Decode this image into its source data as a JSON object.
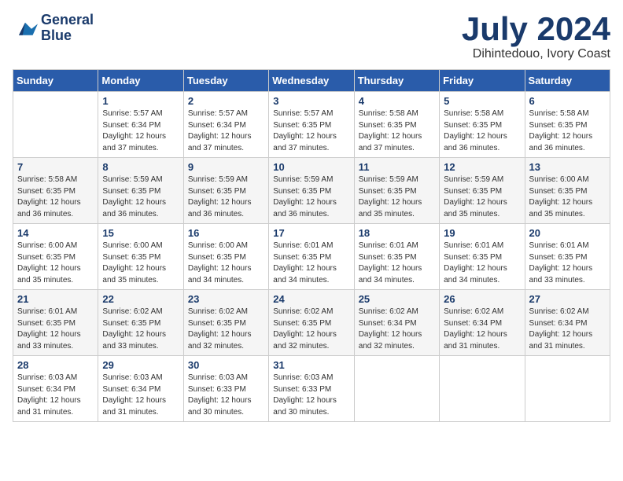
{
  "logo": {
    "line1": "General",
    "line2": "Blue"
  },
  "title": "July 2024",
  "location": "Dihintedouo, Ivory Coast",
  "headers": [
    "Sunday",
    "Monday",
    "Tuesday",
    "Wednesday",
    "Thursday",
    "Friday",
    "Saturday"
  ],
  "weeks": [
    [
      {
        "day": "",
        "info": ""
      },
      {
        "day": "1",
        "info": "Sunrise: 5:57 AM\nSunset: 6:34 PM\nDaylight: 12 hours\nand 37 minutes."
      },
      {
        "day": "2",
        "info": "Sunrise: 5:57 AM\nSunset: 6:34 PM\nDaylight: 12 hours\nand 37 minutes."
      },
      {
        "day": "3",
        "info": "Sunrise: 5:57 AM\nSunset: 6:35 PM\nDaylight: 12 hours\nand 37 minutes."
      },
      {
        "day": "4",
        "info": "Sunrise: 5:58 AM\nSunset: 6:35 PM\nDaylight: 12 hours\nand 37 minutes."
      },
      {
        "day": "5",
        "info": "Sunrise: 5:58 AM\nSunset: 6:35 PM\nDaylight: 12 hours\nand 36 minutes."
      },
      {
        "day": "6",
        "info": "Sunrise: 5:58 AM\nSunset: 6:35 PM\nDaylight: 12 hours\nand 36 minutes."
      }
    ],
    [
      {
        "day": "7",
        "info": "Sunrise: 5:58 AM\nSunset: 6:35 PM\nDaylight: 12 hours\nand 36 minutes."
      },
      {
        "day": "8",
        "info": "Sunrise: 5:59 AM\nSunset: 6:35 PM\nDaylight: 12 hours\nand 36 minutes."
      },
      {
        "day": "9",
        "info": "Sunrise: 5:59 AM\nSunset: 6:35 PM\nDaylight: 12 hours\nand 36 minutes."
      },
      {
        "day": "10",
        "info": "Sunrise: 5:59 AM\nSunset: 6:35 PM\nDaylight: 12 hours\nand 36 minutes."
      },
      {
        "day": "11",
        "info": "Sunrise: 5:59 AM\nSunset: 6:35 PM\nDaylight: 12 hours\nand 35 minutes."
      },
      {
        "day": "12",
        "info": "Sunrise: 5:59 AM\nSunset: 6:35 PM\nDaylight: 12 hours\nand 35 minutes."
      },
      {
        "day": "13",
        "info": "Sunrise: 6:00 AM\nSunset: 6:35 PM\nDaylight: 12 hours\nand 35 minutes."
      }
    ],
    [
      {
        "day": "14",
        "info": "Sunrise: 6:00 AM\nSunset: 6:35 PM\nDaylight: 12 hours\nand 35 minutes."
      },
      {
        "day": "15",
        "info": "Sunrise: 6:00 AM\nSunset: 6:35 PM\nDaylight: 12 hours\nand 35 minutes."
      },
      {
        "day": "16",
        "info": "Sunrise: 6:00 AM\nSunset: 6:35 PM\nDaylight: 12 hours\nand 34 minutes."
      },
      {
        "day": "17",
        "info": "Sunrise: 6:01 AM\nSunset: 6:35 PM\nDaylight: 12 hours\nand 34 minutes."
      },
      {
        "day": "18",
        "info": "Sunrise: 6:01 AM\nSunset: 6:35 PM\nDaylight: 12 hours\nand 34 minutes."
      },
      {
        "day": "19",
        "info": "Sunrise: 6:01 AM\nSunset: 6:35 PM\nDaylight: 12 hours\nand 34 minutes."
      },
      {
        "day": "20",
        "info": "Sunrise: 6:01 AM\nSunset: 6:35 PM\nDaylight: 12 hours\nand 33 minutes."
      }
    ],
    [
      {
        "day": "21",
        "info": "Sunrise: 6:01 AM\nSunset: 6:35 PM\nDaylight: 12 hours\nand 33 minutes."
      },
      {
        "day": "22",
        "info": "Sunrise: 6:02 AM\nSunset: 6:35 PM\nDaylight: 12 hours\nand 33 minutes."
      },
      {
        "day": "23",
        "info": "Sunrise: 6:02 AM\nSunset: 6:35 PM\nDaylight: 12 hours\nand 32 minutes."
      },
      {
        "day": "24",
        "info": "Sunrise: 6:02 AM\nSunset: 6:35 PM\nDaylight: 12 hours\nand 32 minutes."
      },
      {
        "day": "25",
        "info": "Sunrise: 6:02 AM\nSunset: 6:34 PM\nDaylight: 12 hours\nand 32 minutes."
      },
      {
        "day": "26",
        "info": "Sunrise: 6:02 AM\nSunset: 6:34 PM\nDaylight: 12 hours\nand 31 minutes."
      },
      {
        "day": "27",
        "info": "Sunrise: 6:02 AM\nSunset: 6:34 PM\nDaylight: 12 hours\nand 31 minutes."
      }
    ],
    [
      {
        "day": "28",
        "info": "Sunrise: 6:03 AM\nSunset: 6:34 PM\nDaylight: 12 hours\nand 31 minutes."
      },
      {
        "day": "29",
        "info": "Sunrise: 6:03 AM\nSunset: 6:34 PM\nDaylight: 12 hours\nand 31 minutes."
      },
      {
        "day": "30",
        "info": "Sunrise: 6:03 AM\nSunset: 6:33 PM\nDaylight: 12 hours\nand 30 minutes."
      },
      {
        "day": "31",
        "info": "Sunrise: 6:03 AM\nSunset: 6:33 PM\nDaylight: 12 hours\nand 30 minutes."
      },
      {
        "day": "",
        "info": ""
      },
      {
        "day": "",
        "info": ""
      },
      {
        "day": "",
        "info": ""
      }
    ]
  ]
}
